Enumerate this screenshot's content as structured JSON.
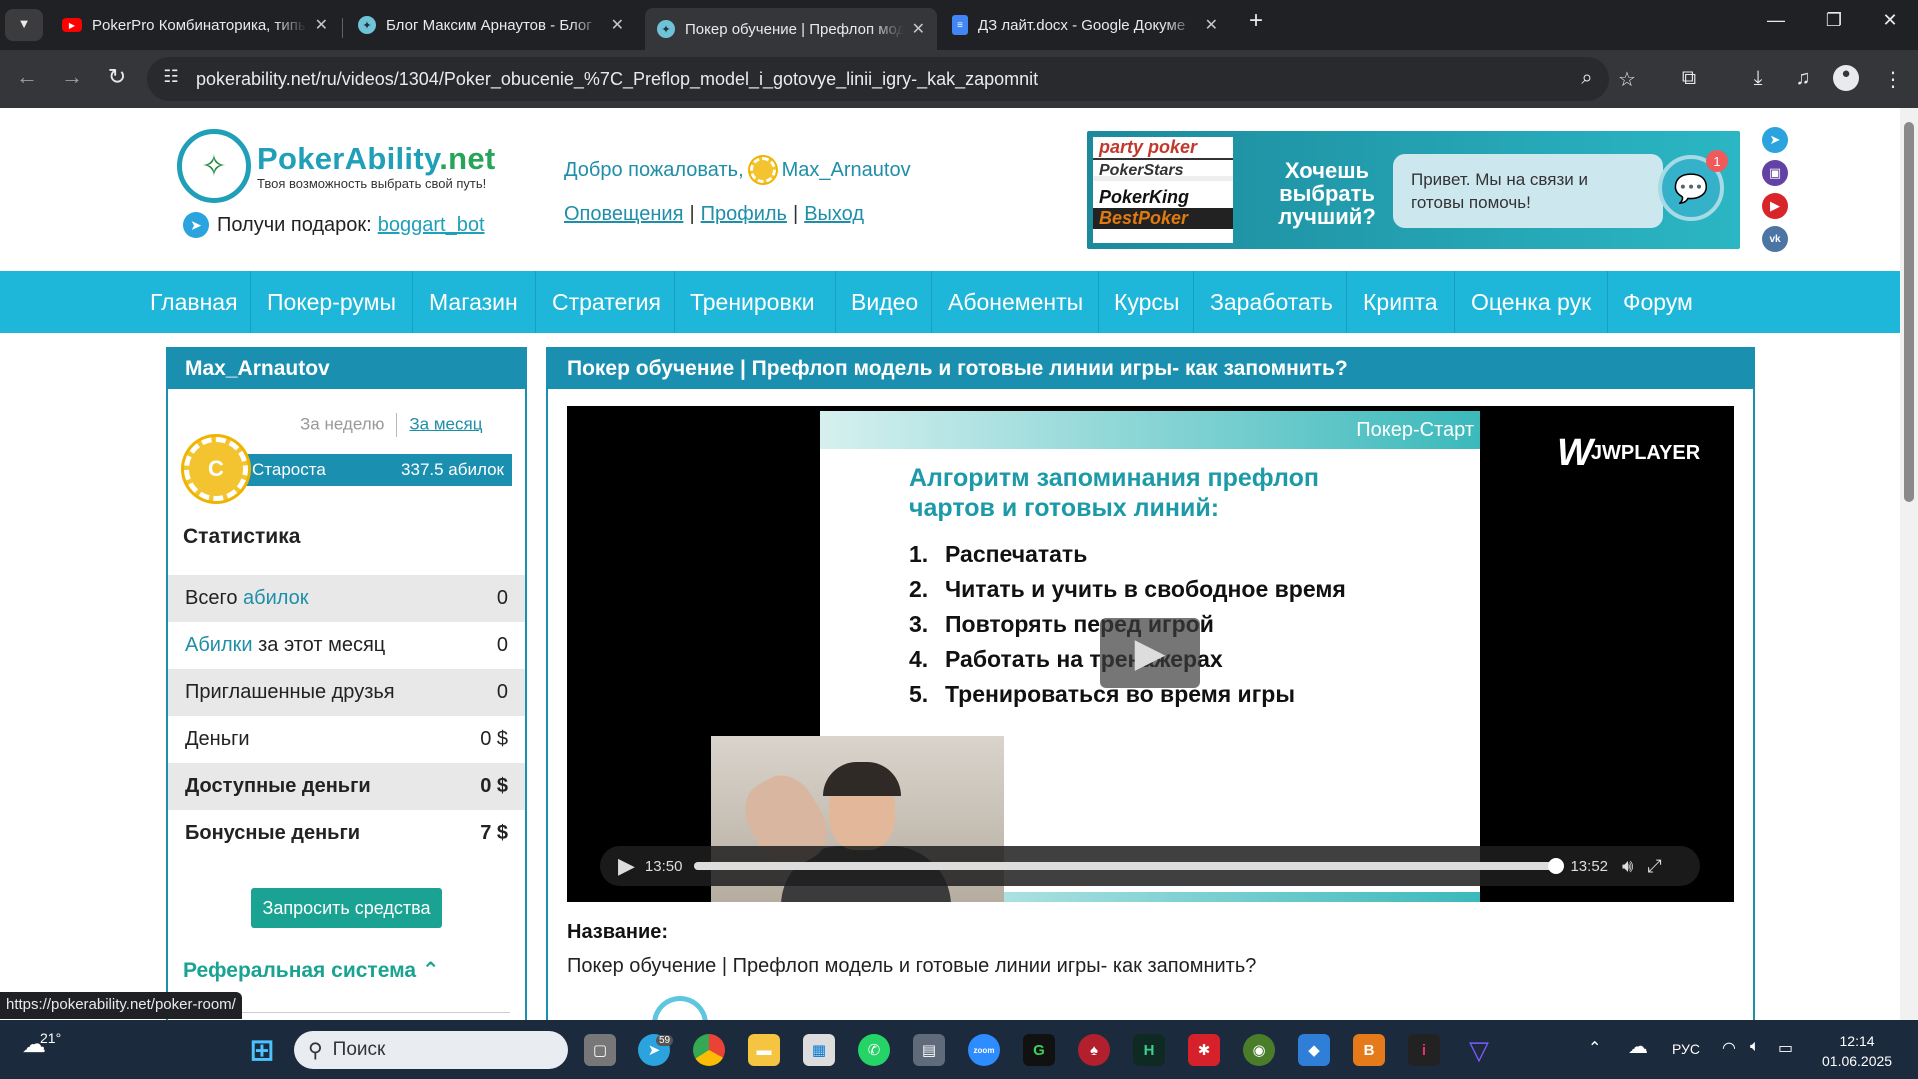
{
  "browser": {
    "tabs": [
      {
        "title": "PokerPro Комбинаторика, типы",
        "icon": "youtube-icon"
      },
      {
        "title": "Блог Максим Арнаутов - Блог",
        "icon": "globe-icon"
      },
      {
        "title": "Покер обучение | Префлоп модель",
        "icon": "globe-icon"
      },
      {
        "title": "ДЗ лайт.docx - Google Докуме",
        "icon": "google-docs-icon"
      }
    ],
    "url": "pokerability.net/ru/videos/1304/Poker_obucenie_%7C_Preflop_model_i_gotovye_linii_igry-_kak_zapomnit",
    "status_url": "https://pokerability.net/poker-room/"
  },
  "header": {
    "logo_name": "PokerAbility",
    "logo_tld": ".net",
    "logo_tagline": "Твоя возможность выбрать свой путь!",
    "gift_label": "Получи подарок:",
    "gift_link": "boggart_bot",
    "welcome": "Добро пожаловать,",
    "username": "Max_Arnautov",
    "links": [
      "Оповещения",
      "Профиль",
      "Выход"
    ],
    "banner_brands": [
      "party poker",
      "PokerStars",
      "PokerKing",
      "BestPoker"
    ],
    "banner_text": "Хочешь выбрать лучший?",
    "chat_text": "Привет. Мы на связи и готовы помочь!",
    "chat_badge": "1"
  },
  "menu": [
    "Главная",
    "Покер-румы",
    "Магазин",
    "Стратегия",
    "Тренировки",
    "Видео",
    "Абонементы",
    "Курсы",
    "Заработать",
    "Крипта",
    "Оценка рук",
    "Форум"
  ],
  "sidebar": {
    "title": "Max_Arnautov",
    "period_week": "За неделю",
    "period_month": "За месяц",
    "rank_coin": "C",
    "rank_name": "Староста",
    "rank_points": "337.5 абилок",
    "stats_title": "Статистика",
    "stats": [
      {
        "pre": "Всего ",
        "hl": "абилок",
        "post": "",
        "value": "0"
      },
      {
        "pre": "",
        "hl": "Абилки",
        "post": " за этот месяц",
        "value": "0"
      },
      {
        "pre": "Приглашенные друзья",
        "hl": "",
        "post": "",
        "value": "0"
      },
      {
        "pre": "Деньги",
        "hl": "",
        "post": "",
        "value": "0 $"
      },
      {
        "pre": "Доступные деньги",
        "hl": "",
        "post": "",
        "value": "0 $"
      },
      {
        "pre": "Бонусные деньги",
        "hl": "",
        "post": "",
        "value": "7 $"
      }
    ],
    "request_button": "Запросить средства",
    "referral": "Реферальная система"
  },
  "main": {
    "title": "Покер обучение | Префлоп модель и готовые линии игры- как запомнить?",
    "video": {
      "slide_header": "Покер-Старт",
      "slide_title": "Алгоритм запоминания префлоп чартов и готовых линий:",
      "slide_items": [
        "Распечатать",
        "Читать и учить в свободное время",
        "Повторять перед игрой",
        "Работать на тренажерах",
        "Тренироваться во время игры"
      ],
      "player_brand": "JWPLAYER",
      "time_current": "13:50",
      "time_total": "13:52",
      "progress": 0.9976
    },
    "name_label": "Название:",
    "name_value": "Покер обучение | Префлоп модель и готовые линии игры- как запомнить?"
  },
  "taskbar": {
    "weather": "21°",
    "search_placeholder": "Поиск",
    "telegram_badge": "59",
    "lang": "РУС",
    "time": "12:14",
    "date": "01.06.2025"
  },
  "colors": {
    "accent": "#1eb7d9",
    "panel": "#1b8fb0",
    "green": "#1aa392"
  }
}
